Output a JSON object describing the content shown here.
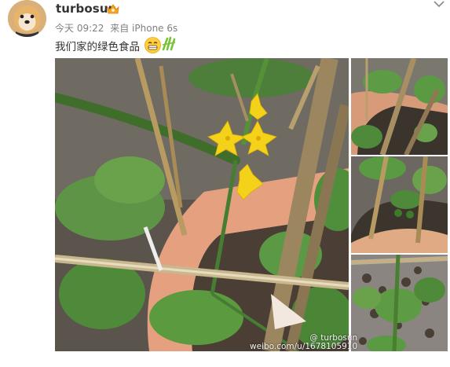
{
  "post": {
    "username": "turbosun",
    "time": "今天 09:22",
    "source": "来自 iPhone 6s",
    "text": "我们家的绿色食品"
  },
  "watermark": {
    "handle": "@ turbosun",
    "url": "weibo.com/u/1678105910"
  },
  "icons": {
    "avatar": "avatar-dog",
    "badge": "vip-crown-icon",
    "menu": "chevron-down-icon",
    "emoji1": "grin-emoji",
    "emoji2": "cheer-emoji"
  },
  "colors": {
    "leaf_green": "#5a8f3c",
    "flower_yellow": "#f4d21a",
    "pot": "#e7a07a",
    "soil": "#4a3f35"
  }
}
